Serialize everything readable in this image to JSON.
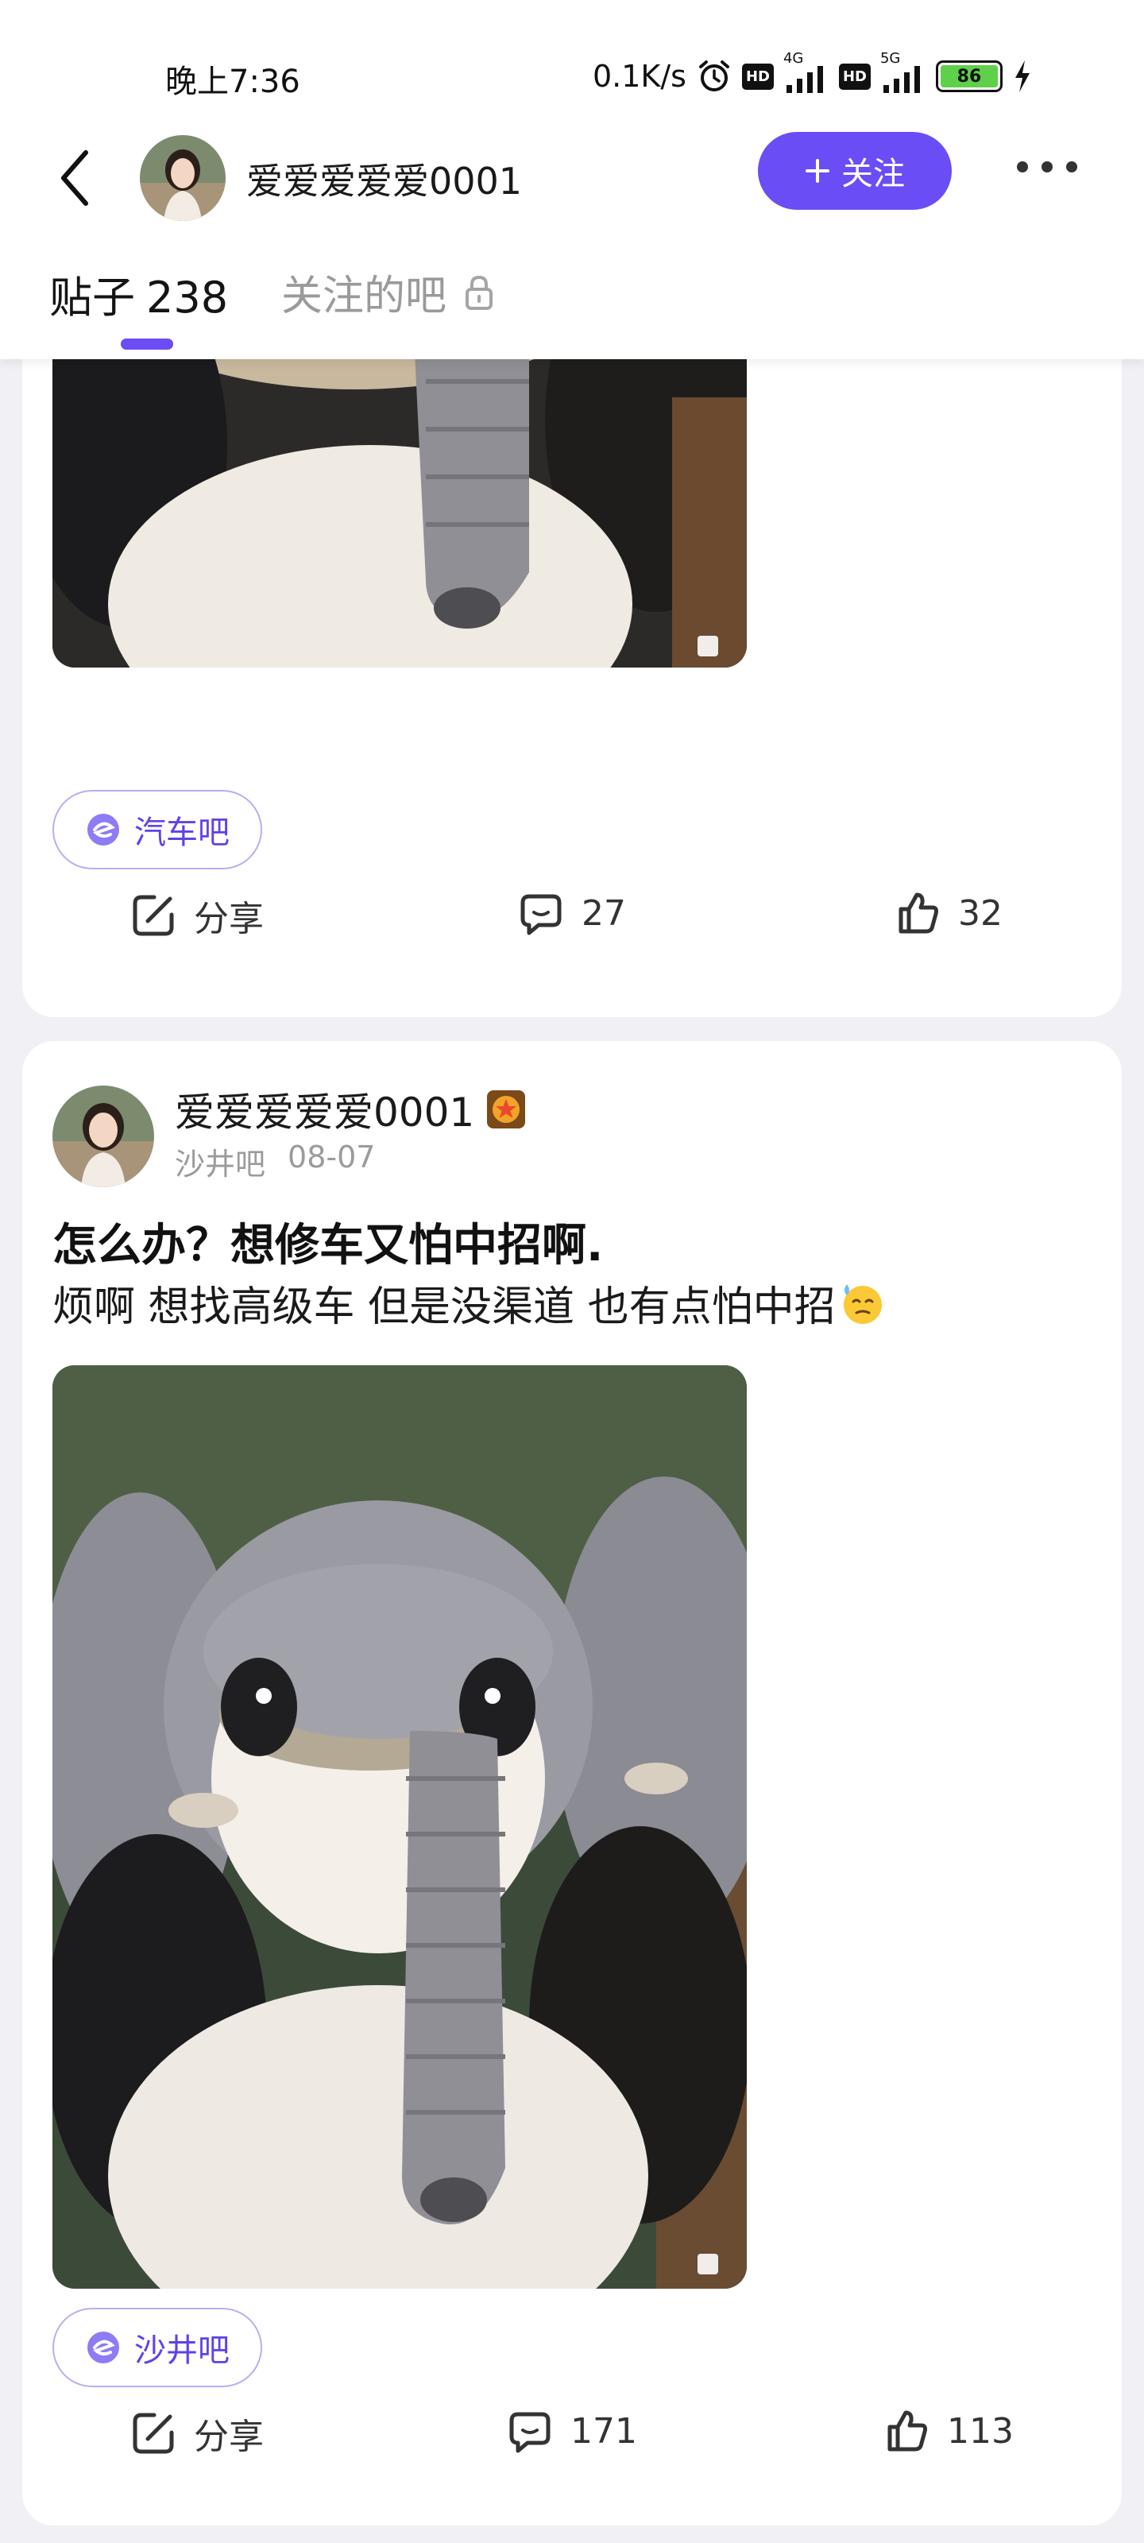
{
  "status_bar": {
    "time": "晚上7:36",
    "network_speed": "0.1K/s",
    "signal_1_label": "4G",
    "signal_2_label": "5G",
    "hd_label": "HD",
    "battery_level": "86",
    "icons": [
      "alarm-icon",
      "hd-icon",
      "signal-icon",
      "charging-icon"
    ]
  },
  "nav": {
    "username": "爱爱爱爱爱0001",
    "follow_label": "关注"
  },
  "tabs": {
    "posts_label": "贴子",
    "posts_count": "238",
    "followed_bars_label": "关注的吧"
  },
  "posts": [
    {
      "forum_tag": "汽车吧",
      "share_label": "分享",
      "comment_count": "27",
      "like_count": "32"
    },
    {
      "author": "爱爱爱爱爱0001",
      "forum": "沙井吧",
      "date": "08-07",
      "title": "怎么办？想修车又怕中招啊.",
      "body": "烦啊 想找高级车 但是没渠道 也有点怕中招",
      "forum_tag": "沙井吧",
      "share_label": "分享",
      "comment_count": "171",
      "like_count": "113"
    }
  ],
  "colors": {
    "accent": "#6a4df4",
    "page_bg": "#f1f1f5",
    "card_bg": "#ffffff"
  }
}
